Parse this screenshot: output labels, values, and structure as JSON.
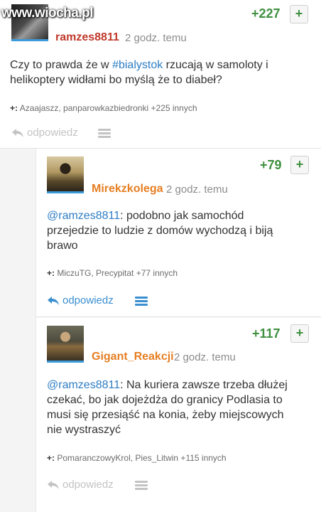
{
  "watermark": "www.wiocha.pl",
  "colors": {
    "score": "#3f8f3f",
    "link": "#2e7dc4",
    "reply_active": "#3b8fd0",
    "reply_dim": "#c3c3c3",
    "author_red": "#c0392b",
    "author_orange": "#e67e22",
    "avatar_underline": "#3b9ad9"
  },
  "comments": [
    {
      "author": "ramzes8811",
      "time": "2 godz. temu",
      "score": "+227",
      "plus_label": "+",
      "text_pre": "Czy to prawda że w ",
      "tag": "#bialystok",
      "text_post": " rzucają w samoloty i helikoptery widłami bo myślą że to diabeł?",
      "voters_prefix": "+:",
      "voters": "Azaajaszz, panparowkazbiedronki +225 innych",
      "reply_label": "odpowiedz",
      "reply_icon": "reply-arrow-icon",
      "menu_icon": "menu-lines-icon"
    },
    {
      "author": "Mirekzkolega",
      "time": "2 godz. temu",
      "score": "+79",
      "plus_label": "+",
      "mention": "@ramzes8811",
      "text": ": podobno jak samochód przejedzie to ludzie z domów wychodzą i biją brawo",
      "voters_prefix": "+:",
      "voters": "MiczuTG, Precypitat +77 innych",
      "reply_label": "odpowiedz",
      "reply_icon": "reply-arrow-icon",
      "menu_icon": "menu-lines-icon"
    },
    {
      "author": "Gigant_Reakcji",
      "time": "2 godz. temu",
      "score": "+117",
      "plus_label": "+",
      "mention": "@ramzes8811",
      "text": ": Na kuriera zawsze trzeba dłużej czekać, bo jak dojeżdża do granicy Podlasia to musi się przesiąść na konia, żeby miejscowych nie wystraszyć",
      "voters_prefix": "+:",
      "voters": "PomaranczowyKrol, Pies_Litwin +115 innych",
      "reply_label": "odpowiedz",
      "reply_icon": "reply-arrow-icon",
      "menu_icon": "menu-lines-icon"
    }
  ]
}
